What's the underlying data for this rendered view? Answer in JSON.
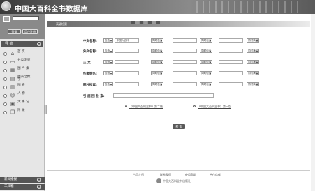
{
  "header": {
    "title": "中国大百科全书数据库"
  },
  "login": {
    "login_label": "登录",
    "register_label": "用户注册"
  },
  "nav": {
    "heading": "导  航",
    "items": [
      {
        "label": "首  页",
        "icon": "home-icon"
      },
      {
        "label": "分类浏览",
        "icon": "folder-icon"
      },
      {
        "label": "图 片 集",
        "icon": "image-icon"
      },
      {
        "label": "图表之数字",
        "icon": "chart-icon"
      },
      {
        "label": "图  表",
        "icon": "table-icon"
      },
      {
        "label": "人  物",
        "icon": "person-icon"
      },
      {
        "label": "大 事 记",
        "icon": "calendar-icon"
      },
      {
        "label": "附  录",
        "icon": "book-icon"
      }
    ],
    "bottom1": "新闻播报",
    "bottom2": "工具箱"
  },
  "main": {
    "tab_title": "高级检索",
    "rows": [
      {
        "label": "中文名称:",
        "op": "包含",
        "value": "中国大百科",
        "logic1": "同时包含",
        "logic2": "同时包含",
        "logic3": "同时满足"
      },
      {
        "label": "外文名称:",
        "op": "包含",
        "value": "",
        "logic1": "同时包含",
        "logic2": "同时包含",
        "logic3": "同时满足"
      },
      {
        "label": "正    文:",
        "op": "包含",
        "value": "",
        "logic1": "同时包含",
        "logic2": "同时包含",
        "logic3": "同时满足"
      },
      {
        "label": "作者姓名:",
        "op": "包含",
        "value": "",
        "logic1": "同时包含",
        "logic2": "同时包含",
        "logic3": "同时满足"
      },
      {
        "label": "图片检索:",
        "op": "包含",
        "value": "",
        "logic1": "同时包含",
        "logic2": "同时包含",
        "logic3": "同时满足"
      }
    ],
    "range_label": "引 底 回 检 索:",
    "scope1": "《中国大百科全书》第二版",
    "scope2": "《中国大百科全书》第一版",
    "search_button": "检 索"
  },
  "footer": {
    "links": [
      "产品介绍",
      "联系我们",
      "使用帮助",
      "合作伙伴"
    ],
    "copyright": "中国大百科全书出版社"
  }
}
